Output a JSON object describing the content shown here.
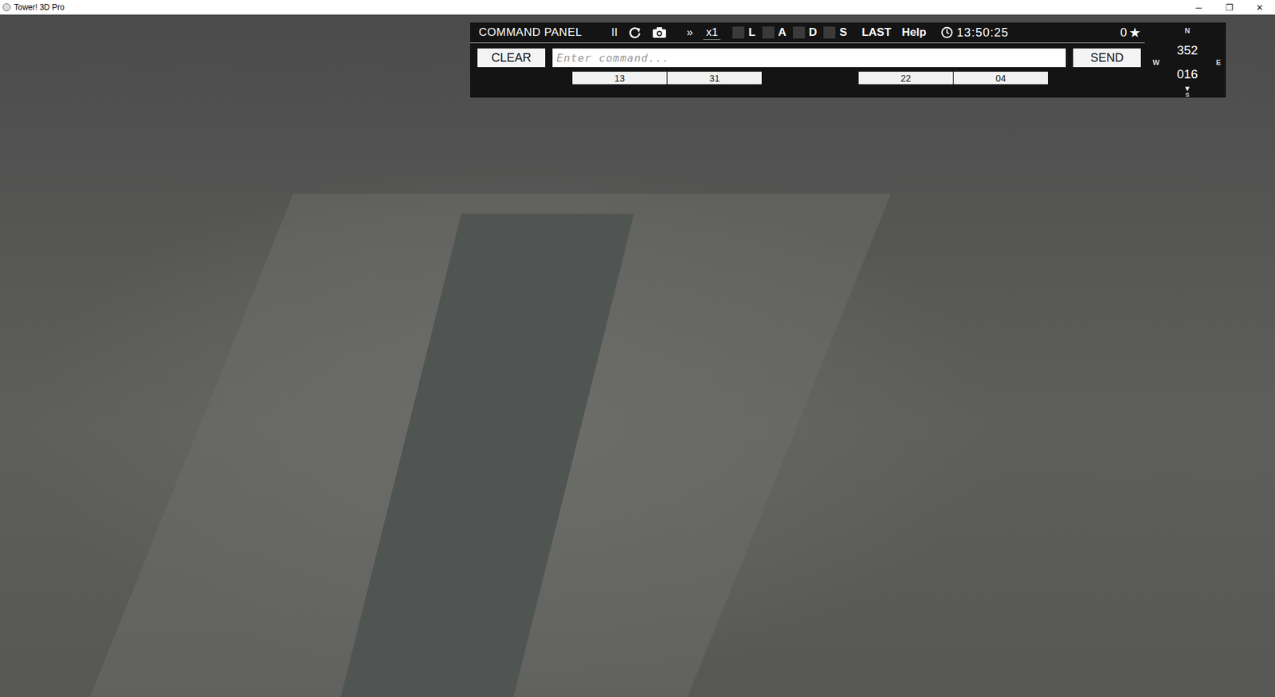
{
  "window": {
    "title": "Tower! 3D Pro",
    "controls": [
      "─",
      "❐",
      "✕"
    ]
  },
  "command_panel": {
    "title": "COMMAND PANEL",
    "pause": "II",
    "fast_forward": "»",
    "speed": "x1",
    "filters": [
      {
        "label": "L",
        "checked": false
      },
      {
        "label": "A",
        "checked": false
      },
      {
        "label": "D",
        "checked": false
      },
      {
        "label": "S",
        "checked": false
      }
    ],
    "last": "LAST",
    "help": "Help",
    "time": "13:50:25",
    "score": "0",
    "star": "★",
    "clear": "CLEAR",
    "input": {
      "placeholder": "Enter command..."
    },
    "send": "SEND",
    "runway_groups": [
      [
        "13",
        "31"
      ],
      [
        "22",
        "04"
      ]
    ],
    "compass": {
      "n": "N",
      "w": "W",
      "e": "E",
      "s": "S",
      "heading": "352",
      "reading": "016",
      "arrow": "▼"
    }
  }
}
